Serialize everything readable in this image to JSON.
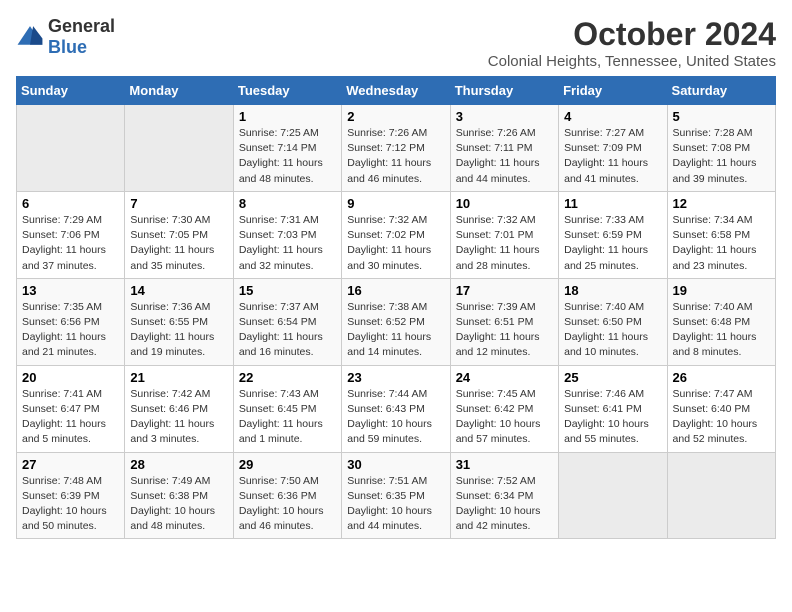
{
  "logo": {
    "general": "General",
    "blue": "Blue"
  },
  "title": "October 2024",
  "subtitle": "Colonial Heights, Tennessee, United States",
  "days_of_week": [
    "Sunday",
    "Monday",
    "Tuesday",
    "Wednesday",
    "Thursday",
    "Friday",
    "Saturday"
  ],
  "weeks": [
    [
      {
        "day": "",
        "info": ""
      },
      {
        "day": "",
        "info": ""
      },
      {
        "day": "1",
        "info": "Sunrise: 7:25 AM\nSunset: 7:14 PM\nDaylight: 11 hours and 48 minutes."
      },
      {
        "day": "2",
        "info": "Sunrise: 7:26 AM\nSunset: 7:12 PM\nDaylight: 11 hours and 46 minutes."
      },
      {
        "day": "3",
        "info": "Sunrise: 7:26 AM\nSunset: 7:11 PM\nDaylight: 11 hours and 44 minutes."
      },
      {
        "day": "4",
        "info": "Sunrise: 7:27 AM\nSunset: 7:09 PM\nDaylight: 11 hours and 41 minutes."
      },
      {
        "day": "5",
        "info": "Sunrise: 7:28 AM\nSunset: 7:08 PM\nDaylight: 11 hours and 39 minutes."
      }
    ],
    [
      {
        "day": "6",
        "info": "Sunrise: 7:29 AM\nSunset: 7:06 PM\nDaylight: 11 hours and 37 minutes."
      },
      {
        "day": "7",
        "info": "Sunrise: 7:30 AM\nSunset: 7:05 PM\nDaylight: 11 hours and 35 minutes."
      },
      {
        "day": "8",
        "info": "Sunrise: 7:31 AM\nSunset: 7:03 PM\nDaylight: 11 hours and 32 minutes."
      },
      {
        "day": "9",
        "info": "Sunrise: 7:32 AM\nSunset: 7:02 PM\nDaylight: 11 hours and 30 minutes."
      },
      {
        "day": "10",
        "info": "Sunrise: 7:32 AM\nSunset: 7:01 PM\nDaylight: 11 hours and 28 minutes."
      },
      {
        "day": "11",
        "info": "Sunrise: 7:33 AM\nSunset: 6:59 PM\nDaylight: 11 hours and 25 minutes."
      },
      {
        "day": "12",
        "info": "Sunrise: 7:34 AM\nSunset: 6:58 PM\nDaylight: 11 hours and 23 minutes."
      }
    ],
    [
      {
        "day": "13",
        "info": "Sunrise: 7:35 AM\nSunset: 6:56 PM\nDaylight: 11 hours and 21 minutes."
      },
      {
        "day": "14",
        "info": "Sunrise: 7:36 AM\nSunset: 6:55 PM\nDaylight: 11 hours and 19 minutes."
      },
      {
        "day": "15",
        "info": "Sunrise: 7:37 AM\nSunset: 6:54 PM\nDaylight: 11 hours and 16 minutes."
      },
      {
        "day": "16",
        "info": "Sunrise: 7:38 AM\nSunset: 6:52 PM\nDaylight: 11 hours and 14 minutes."
      },
      {
        "day": "17",
        "info": "Sunrise: 7:39 AM\nSunset: 6:51 PM\nDaylight: 11 hours and 12 minutes."
      },
      {
        "day": "18",
        "info": "Sunrise: 7:40 AM\nSunset: 6:50 PM\nDaylight: 11 hours and 10 minutes."
      },
      {
        "day": "19",
        "info": "Sunrise: 7:40 AM\nSunset: 6:48 PM\nDaylight: 11 hours and 8 minutes."
      }
    ],
    [
      {
        "day": "20",
        "info": "Sunrise: 7:41 AM\nSunset: 6:47 PM\nDaylight: 11 hours and 5 minutes."
      },
      {
        "day": "21",
        "info": "Sunrise: 7:42 AM\nSunset: 6:46 PM\nDaylight: 11 hours and 3 minutes."
      },
      {
        "day": "22",
        "info": "Sunrise: 7:43 AM\nSunset: 6:45 PM\nDaylight: 11 hours and 1 minute."
      },
      {
        "day": "23",
        "info": "Sunrise: 7:44 AM\nSunset: 6:43 PM\nDaylight: 10 hours and 59 minutes."
      },
      {
        "day": "24",
        "info": "Sunrise: 7:45 AM\nSunset: 6:42 PM\nDaylight: 10 hours and 57 minutes."
      },
      {
        "day": "25",
        "info": "Sunrise: 7:46 AM\nSunset: 6:41 PM\nDaylight: 10 hours and 55 minutes."
      },
      {
        "day": "26",
        "info": "Sunrise: 7:47 AM\nSunset: 6:40 PM\nDaylight: 10 hours and 52 minutes."
      }
    ],
    [
      {
        "day": "27",
        "info": "Sunrise: 7:48 AM\nSunset: 6:39 PM\nDaylight: 10 hours and 50 minutes."
      },
      {
        "day": "28",
        "info": "Sunrise: 7:49 AM\nSunset: 6:38 PM\nDaylight: 10 hours and 48 minutes."
      },
      {
        "day": "29",
        "info": "Sunrise: 7:50 AM\nSunset: 6:36 PM\nDaylight: 10 hours and 46 minutes."
      },
      {
        "day": "30",
        "info": "Sunrise: 7:51 AM\nSunset: 6:35 PM\nDaylight: 10 hours and 44 minutes."
      },
      {
        "day": "31",
        "info": "Sunrise: 7:52 AM\nSunset: 6:34 PM\nDaylight: 10 hours and 42 minutes."
      },
      {
        "day": "",
        "info": ""
      },
      {
        "day": "",
        "info": ""
      }
    ]
  ]
}
